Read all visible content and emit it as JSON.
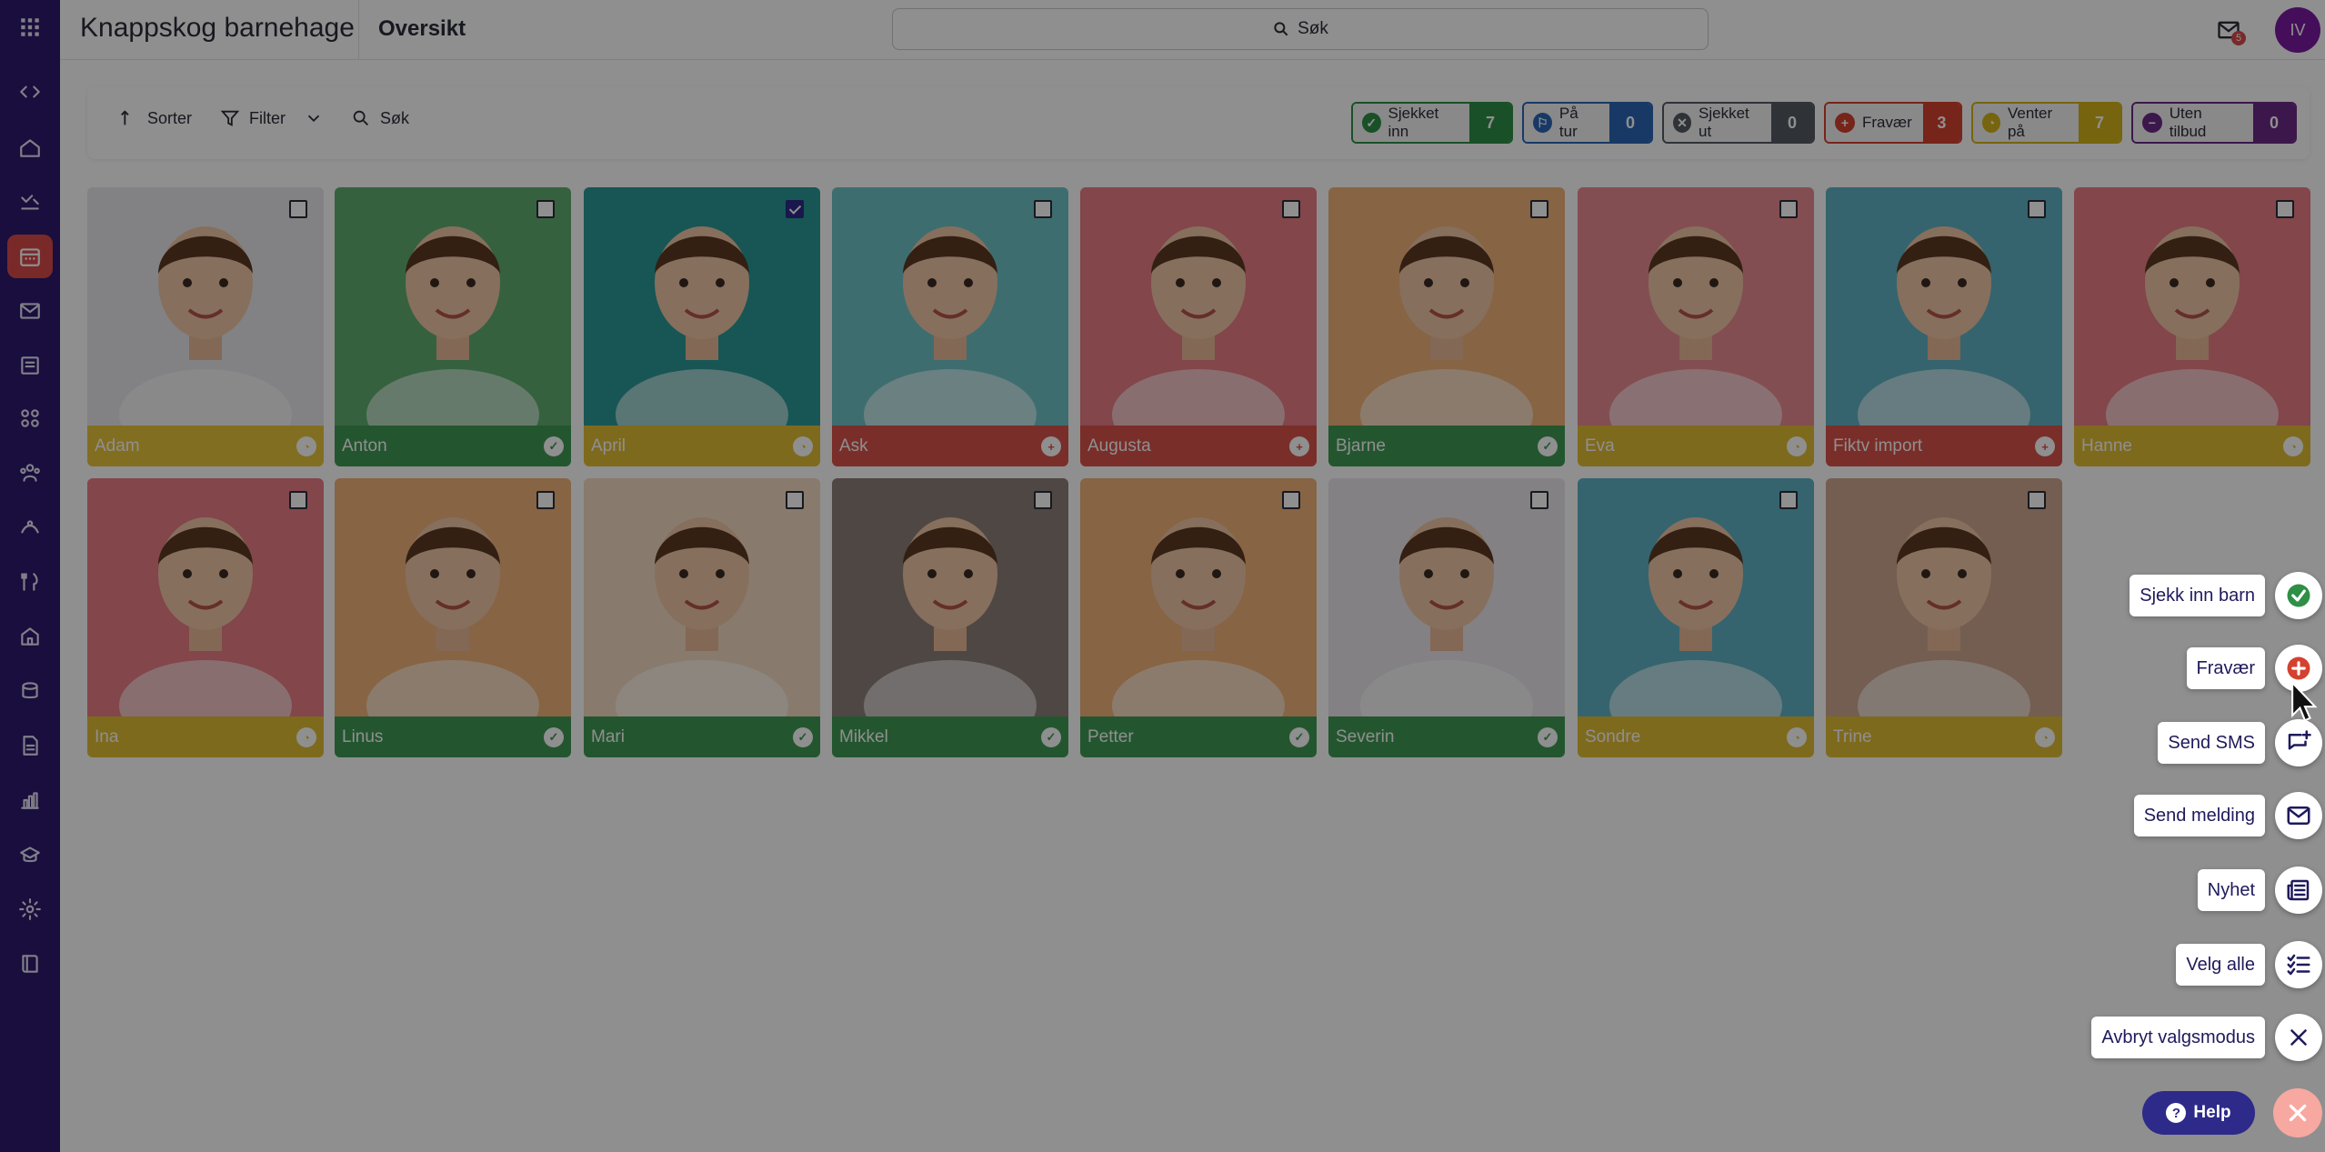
{
  "app": {
    "title": "Knappskog barnehage",
    "page_title": "Oversikt"
  },
  "search": {
    "label": "Søk"
  },
  "notifications": {
    "mail_count": "5",
    "bell_count": "6"
  },
  "user": {
    "initials": "IV"
  },
  "rail": {
    "items": [
      {
        "name": "apps-icon"
      },
      {
        "name": "collapse-icon"
      },
      {
        "name": "home-icon"
      },
      {
        "name": "checkin-icon"
      },
      {
        "name": "calendar-icon"
      },
      {
        "name": "mail-icon"
      },
      {
        "name": "news-icon"
      },
      {
        "name": "groups-icon"
      },
      {
        "name": "children-icon"
      },
      {
        "name": "trips-icon"
      },
      {
        "name": "meals-icon"
      },
      {
        "name": "house-icon"
      },
      {
        "name": "money-icon"
      },
      {
        "name": "document-icon"
      },
      {
        "name": "chart-icon"
      },
      {
        "name": "school-icon"
      },
      {
        "name": "settings-icon"
      },
      {
        "name": "book-icon"
      }
    ],
    "active_index": 4
  },
  "toolbar": {
    "sort_label": "Sorter",
    "filter_label": "Filter",
    "search_label": "Søk"
  },
  "statuses": [
    {
      "label": "Sjekket inn",
      "count": "7",
      "color": "#2f8f46",
      "icon": "check"
    },
    {
      "label": "På tur",
      "count": "0",
      "color": "#2b67b5",
      "icon": "walk"
    },
    {
      "label": "Sjekket ut",
      "count": "0",
      "color": "#555a62",
      "icon": "x"
    },
    {
      "label": "Fravær",
      "count": "3",
      "color": "#d4412f",
      "icon": "plus"
    },
    {
      "label": "Venter på",
      "count": "7",
      "color": "#d3b31a",
      "icon": "clock"
    },
    {
      "label": "Uten tilbud",
      "count": "0",
      "color": "#6b2a86",
      "icon": "minus"
    }
  ],
  "children": [
    {
      "name": "Adam",
      "status": "waiting",
      "bg": "#e8e8ee",
      "bar": "#e8c53a",
      "checked": false
    },
    {
      "name": "Anton",
      "status": "in",
      "bg": "#5fae71",
      "bar": "#3f9a55",
      "checked": false
    },
    {
      "name": "April",
      "status": "waiting",
      "bg": "#2a9a96",
      "bar": "#e0bd34",
      "checked": true
    },
    {
      "name": "Ask",
      "status": "absent",
      "bg": "#6fc3c8",
      "bar": "#d9534a",
      "checked": false
    },
    {
      "name": "Augusta",
      "status": "absent",
      "bg": "#e87e86",
      "bar": "#d9534a",
      "checked": false
    },
    {
      "name": "Bjarne",
      "status": "in",
      "bg": "#f0b27a",
      "bar": "#3f9a55",
      "checked": false
    },
    {
      "name": "Eva",
      "status": "waiting",
      "bg": "#e98b93",
      "bar": "#e0bd34",
      "checked": false
    },
    {
      "name": "Fiktv import",
      "status": "absent",
      "bg": "#5fb3c4",
      "bar": "#d9534a",
      "checked": false
    },
    {
      "name": "Hanne",
      "status": "waiting",
      "bg": "#e87e86",
      "bar": "#e0bd34",
      "checked": false
    },
    {
      "name": "Ina",
      "status": "waiting",
      "bg": "#e87e86",
      "bar": "#e0bd34",
      "checked": false
    },
    {
      "name": "Linus",
      "status": "in",
      "bg": "#f0b27a",
      "bar": "#3f9a55",
      "checked": false
    },
    {
      "name": "Mari",
      "status": "in",
      "bg": "#f2dcc2",
      "bar": "#3f9a55",
      "checked": false
    },
    {
      "name": "Mikkel",
      "status": "in",
      "bg": "#8d7f78",
      "bar": "#3f9a55",
      "checked": false
    },
    {
      "name": "Petter",
      "status": "in",
      "bg": "#f0b27a",
      "bar": "#3f9a55",
      "checked": false
    },
    {
      "name": "Severin",
      "status": "in",
      "bg": "#eae7ec",
      "bar": "#3f9a55",
      "checked": false
    },
    {
      "name": "Sondre",
      "status": "waiting",
      "bg": "#5fb3c4",
      "bar": "#e0bd34",
      "checked": false
    },
    {
      "name": "Trine",
      "status": "waiting",
      "bg": "#cfa890",
      "bar": "#e0bd34",
      "checked": false
    }
  ],
  "actions": [
    {
      "label": "Sjekk inn barn",
      "icon": "check-circle-icon"
    },
    {
      "label": "Fravær",
      "icon": "absence-plus-icon"
    },
    {
      "label": "Send SMS",
      "icon": "sms-icon"
    },
    {
      "label": "Send melding",
      "icon": "envelope-icon"
    },
    {
      "label": "Nyhet",
      "icon": "newspaper-icon"
    },
    {
      "label": "Velg alle",
      "icon": "checklist-icon"
    },
    {
      "label": "Avbryt valgsmodus",
      "icon": "close-icon"
    }
  ],
  "help": {
    "label": "Help"
  }
}
